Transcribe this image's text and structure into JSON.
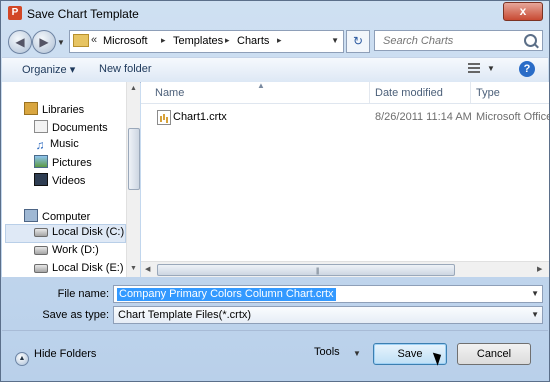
{
  "window": {
    "title": "Save Chart Template",
    "app_icon_letter": "P",
    "close_glyph": "x"
  },
  "address": {
    "chevron": "«",
    "breadcrumbs": [
      "Microsoft",
      "Templates",
      "Charts"
    ],
    "search_placeholder": "Search Charts"
  },
  "toolbar": {
    "organize_label": "Organize ▾",
    "new_folder_label": "New folder"
  },
  "nav_pane": {
    "libraries": "Libraries",
    "documents": "Documents",
    "music": "Music",
    "pictures": "Pictures",
    "videos": "Videos",
    "computer": "Computer",
    "disk_c": "Local Disk (C:)",
    "work_d": "Work (D:)",
    "disk_e": "Local Disk (E:)"
  },
  "columns": {
    "name": "Name",
    "date_modified": "Date modified",
    "type": "Type"
  },
  "files": [
    {
      "name": "Chart1.crtx",
      "date_modified": "8/26/2011 11:14 AM",
      "type": "Microsoft Office"
    }
  ],
  "form": {
    "file_name_label": "File name:",
    "file_name_value": "Company Primary Colors Column Chart.crtx",
    "save_as_type_label": "Save as type:",
    "save_as_type_value": "Chart Template Files(*.crtx)"
  },
  "footer": {
    "hide_folders_label": "Hide Folders",
    "tools_label": "Tools",
    "save_label": "Save",
    "cancel_label": "Cancel"
  },
  "colors": {
    "selection": "#3399ff",
    "accent": "#2a6cc7",
    "window_frame": "#b9d0ea"
  }
}
